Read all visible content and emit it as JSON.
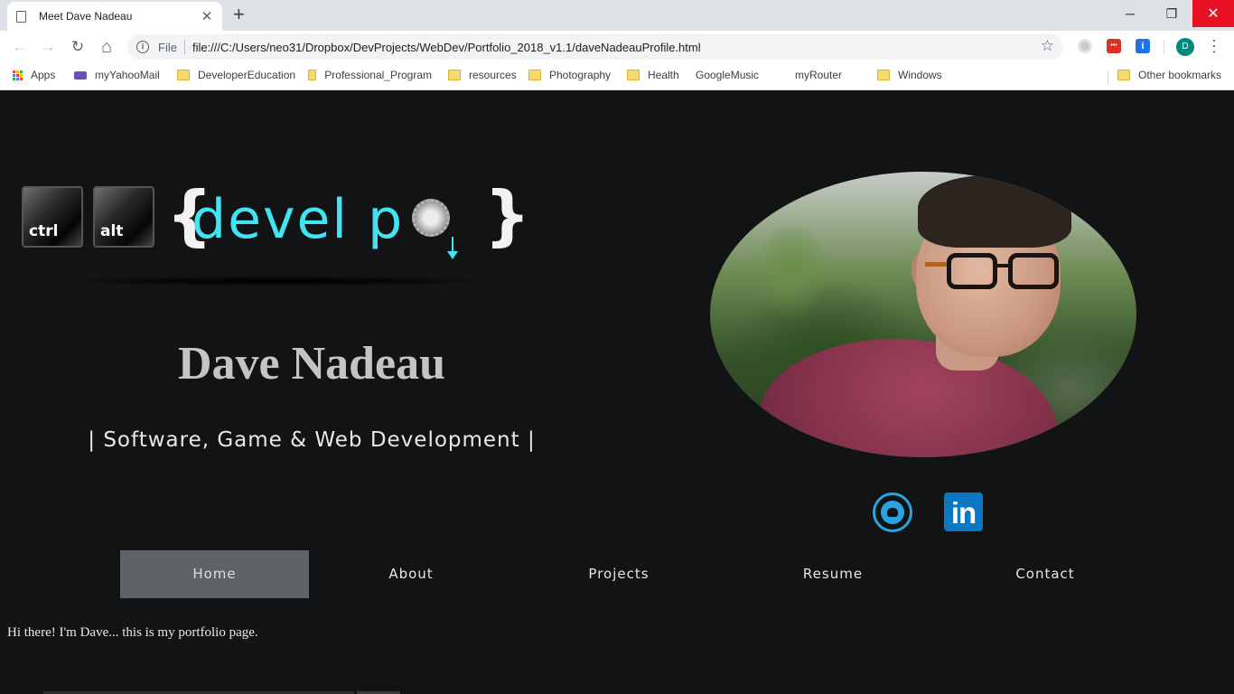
{
  "browser": {
    "tab_title": "Meet Dave Nadeau",
    "tab_close": "✕",
    "new_tab": "+",
    "window_min": "─",
    "window_max": "❐",
    "window_close": "✕",
    "back": "←",
    "forward": "→",
    "reload": "↻",
    "home": "⌂",
    "url_scheme": "File",
    "url": "file:///C:/Users/neo31/Dropbox/DevProjects/WebDev/Portfolio_2018_v1.1/daveNadeauProfile.html",
    "bookmark_star": "☆",
    "profile_initial": "D",
    "menu": "⋮",
    "extension_2_label": "•••",
    "extension_3_label": "i"
  },
  "bookmarks": {
    "items": [
      {
        "label": "Apps",
        "icon": "apps-grid-icon"
      },
      {
        "label": "myYahooMail",
        "icon": "mail-icon"
      },
      {
        "label": "DeveloperEducation",
        "icon": "folder-icon"
      },
      {
        "label": "Professional_Program",
        "icon": "folder-icon"
      },
      {
        "label": "resources",
        "icon": "folder-icon"
      },
      {
        "label": "Photography",
        "icon": "folder-icon"
      },
      {
        "label": "Health",
        "icon": "folder-icon"
      },
      {
        "label": "GoogleMusic",
        "icon": "page-icon"
      },
      {
        "label": "myRouter",
        "icon": "page-icon"
      },
      {
        "label": "Windows",
        "icon": "folder-icon"
      }
    ],
    "other": "Other bookmarks"
  },
  "logo": {
    "key1": "ctrl",
    "key2": "alt",
    "brace_open": "{",
    "brace_close": "}",
    "word": "devel p",
    "accent_color": "#40e4f2"
  },
  "profile": {
    "name": "Dave Nadeau",
    "tagline": "| Software, Game & Web Development |"
  },
  "social": {
    "github_icon": "github-icon",
    "linkedin_icon": "linkedin-icon",
    "linkedin_text": "in"
  },
  "nav": {
    "items": [
      {
        "label": "Home",
        "active": true
      },
      {
        "label": "About",
        "active": false
      },
      {
        "label": "Projects",
        "active": false
      },
      {
        "label": "Resume",
        "active": false
      },
      {
        "label": "Contact",
        "active": false
      }
    ]
  },
  "content": {
    "intro": "Hi there! I'm Dave... this is my portfolio page."
  },
  "colors": {
    "page_bg": "#121314",
    "nav_active_bg": "#5d6367",
    "social_blue": "#2aa3e0",
    "linkedin_blue": "#0a78c2"
  }
}
